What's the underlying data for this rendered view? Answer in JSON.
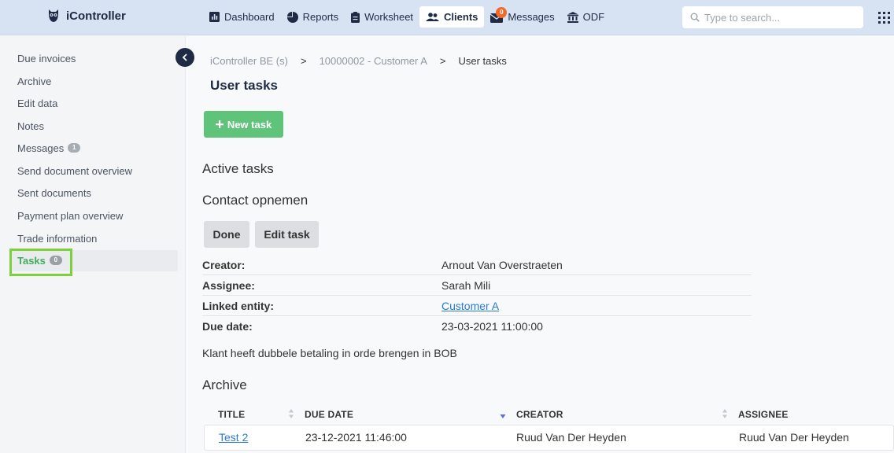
{
  "app": {
    "name": "iController"
  },
  "nav": [
    {
      "label": "Dashboard",
      "icon": "dashboard-icon"
    },
    {
      "label": "Reports",
      "icon": "pie-chart-icon"
    },
    {
      "label": "Worksheet",
      "icon": "clipboard-icon"
    },
    {
      "label": "Clients",
      "icon": "users-icon",
      "active": true
    },
    {
      "label": "Messages",
      "icon": "envelope-icon",
      "badge": "0"
    },
    {
      "label": "ODF",
      "icon": "bank-icon"
    }
  ],
  "search": {
    "placeholder": "Type to search..."
  },
  "sidebar": {
    "items": [
      {
        "label": "Due invoices"
      },
      {
        "label": "Archive"
      },
      {
        "label": "Edit data"
      },
      {
        "label": "Notes"
      },
      {
        "label": "Messages",
        "badge": "1"
      },
      {
        "label": "Send document overview"
      },
      {
        "label": "Sent documents"
      },
      {
        "label": "Payment plan overview"
      },
      {
        "label": "Trade information"
      },
      {
        "label": "Tasks",
        "badge": "0",
        "active": true
      }
    ]
  },
  "breadcrumb": [
    "iController BE (s)",
    "10000002 - Customer A",
    "User tasks"
  ],
  "page": {
    "title": "User tasks",
    "new_task_label": "New task",
    "active_heading": "Active tasks",
    "task_title": "Contact opnemen",
    "done_label": "Done",
    "edit_label": "Edit task",
    "details": [
      {
        "label": "Creator:",
        "value": "Arnout Van Overstraeten"
      },
      {
        "label": "Assignee:",
        "value": "Sarah Mili"
      },
      {
        "label": "Linked entity:",
        "value": "Customer A",
        "link": true
      },
      {
        "label": "Due date:",
        "value": "23-03-2021 11:00:00"
      }
    ],
    "description": "Klant heeft dubbele betaling in orde brengen in BOB",
    "archive_heading": "Archive"
  },
  "archive_table": {
    "columns": [
      "TITLE",
      "DUE DATE",
      "CREATOR",
      "ASSIGNEE"
    ],
    "rows": [
      [
        "Test 2",
        "23-12-2021 11:46:00",
        "Ruud Van Der Heyden",
        "Ruud Van Der Heyden"
      ]
    ]
  },
  "colors": {
    "topbar": "#d7e2f3",
    "accent_green": "#5fc47a",
    "active_green": "#3fae5a",
    "highlight_green": "#7cd13a",
    "link_blue": "#2a7bd1",
    "badge_orange": "#f06a2b"
  }
}
